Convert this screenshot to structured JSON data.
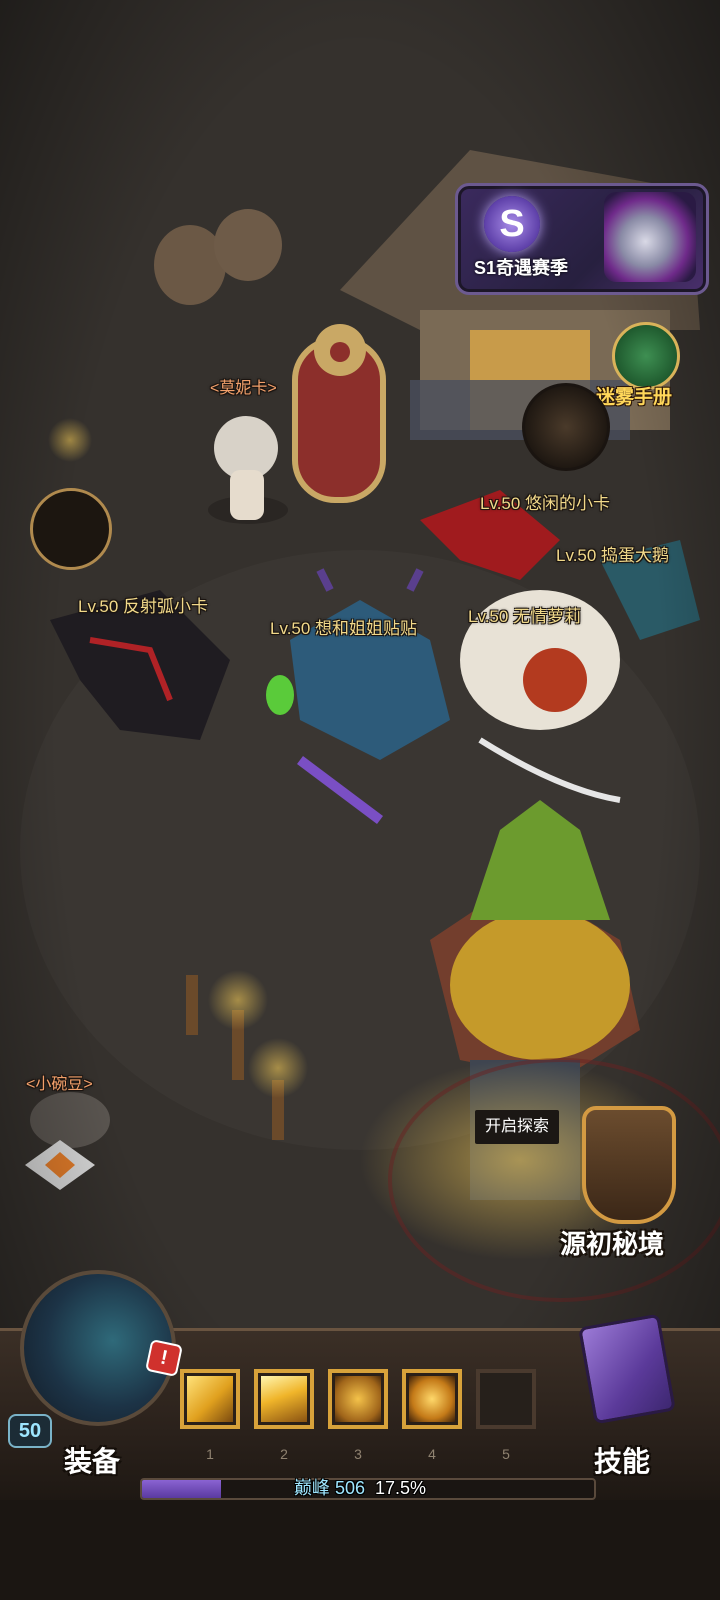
{
  "season": {
    "title": "S1奇遇赛季",
    "logo_letter": "S"
  },
  "fog_manual": {
    "label": "迷雾手册"
  },
  "npcs": [
    {
      "key": "monica",
      "label": "<莫妮卡>"
    },
    {
      "key": "pea",
      "label": "<小碗豆>"
    }
  ],
  "players": [
    {
      "key": "p1",
      "label": "Lv.50 悠闲的小卡"
    },
    {
      "key": "p2",
      "label": "Lv.50 捣蛋大鹅"
    },
    {
      "key": "p3",
      "label": "Lv.50 反射弧小卡"
    },
    {
      "key": "p4",
      "label": "Lv.50 想和姐姐贴贴"
    },
    {
      "key": "p5",
      "label": "Lv.50 无情萝莉"
    }
  ],
  "explore": {
    "tooltip": "开启探索",
    "realm_label": "源初秘境"
  },
  "equipment": {
    "label": "装备",
    "level": "50",
    "alert": "!"
  },
  "skills": {
    "label": "技能",
    "slots": [
      {
        "num": "1",
        "filled": true,
        "icon": "wind-slash-icon"
      },
      {
        "num": "2",
        "filled": true,
        "icon": "blade-beam-icon"
      },
      {
        "num": "3",
        "filled": true,
        "icon": "claw-icon"
      },
      {
        "num": "4",
        "filled": true,
        "icon": "demon-aura-icon"
      },
      {
        "num": "5",
        "filled": false,
        "icon": ""
      }
    ]
  },
  "progress": {
    "tier": "巅峰",
    "points": "506",
    "percent_text": "17.5%",
    "fraction": 0.175
  },
  "colors": {
    "accent_gold": "#ffd75a",
    "xp_purple": "#7a55c6",
    "name_tag": "#f1d98a"
  }
}
